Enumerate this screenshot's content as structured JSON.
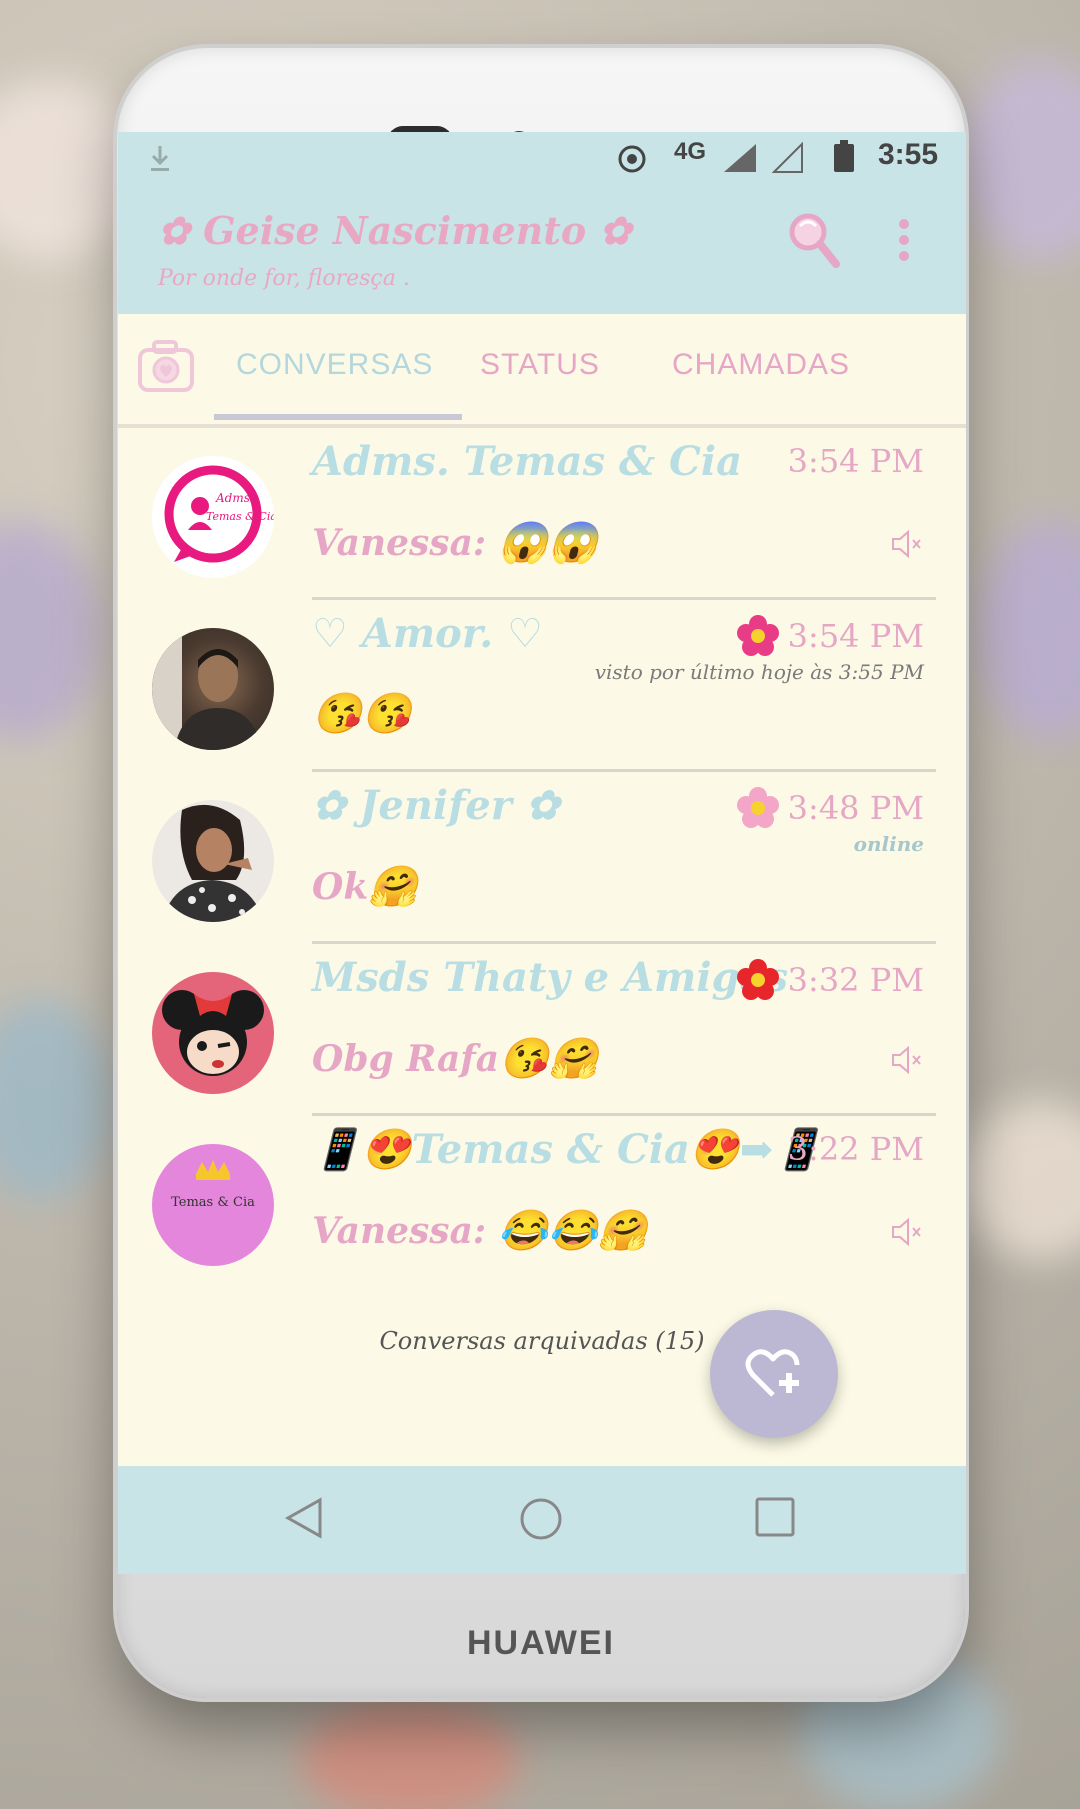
{
  "status_bar": {
    "network": "4G",
    "time": "3:55"
  },
  "app_bar": {
    "title": "✿ Geise Nascimento ✿",
    "subtitle": "Por onde for, floresça ."
  },
  "tabs": [
    {
      "label": "CONVERSAS",
      "selected": true
    },
    {
      "label": "STATUS",
      "selected": false
    },
    {
      "label": "CHAMADAS",
      "selected": false
    }
  ],
  "chats": [
    {
      "name": "Adms. Temas & Cia",
      "time": "3:54 PM",
      "subtitle": "",
      "sender": "Vanessa:",
      "message": "",
      "emojis": "😱😱",
      "muted": true,
      "flower": false,
      "avatar": "pink-logo",
      "avatar_text": [
        "Adms",
        "Temas & Cia"
      ]
    },
    {
      "name": "♡ Amor. ♡",
      "time": "3:54 PM",
      "subtitle": "visto por último hoje às 3:55 PM",
      "sender": "",
      "message": "",
      "emojis": "😘😘",
      "muted": false,
      "flower": true,
      "avatar": "man-photo"
    },
    {
      "name": "✿ Jenifer ✿",
      "time": "3:48 PM",
      "subtitle": "online",
      "sender": "",
      "message": "Ok",
      "emojis": "🤗",
      "muted": false,
      "flower": true,
      "avatar": "woman-photo"
    },
    {
      "name": "Msds Thaty e Amigas",
      "time": "3:32 PM",
      "subtitle": "",
      "sender": "",
      "message": "Obg Rafa",
      "emojis": "😘🤗",
      "muted": true,
      "flower": true,
      "avatar": "minnie"
    },
    {
      "name": "📱😍Temas & Cia😍➡📱",
      "time": "3:22 PM",
      "subtitle": "",
      "sender": "Vanessa:",
      "message": "",
      "emojis": "😂😂🤗",
      "muted": true,
      "flower": false,
      "avatar": "temas-logo",
      "avatar_text": [
        "Temas & Cia"
      ]
    }
  ],
  "archived_label": "Conversas arquivadas (15)",
  "device_brand": "HUAWEI",
  "colors": {
    "header": "#c8e4e7",
    "background": "#fcfae6",
    "pink": "#e6a6c6",
    "light_blue": "#b8dde2",
    "fab": "#bcb8d4"
  },
  "icons": {
    "search": "magnifier-icon",
    "menu": "more-vert-icon",
    "camera": "camera-icon",
    "fab": "heart-plus-icon",
    "mute": "muted-speaker-icon"
  }
}
